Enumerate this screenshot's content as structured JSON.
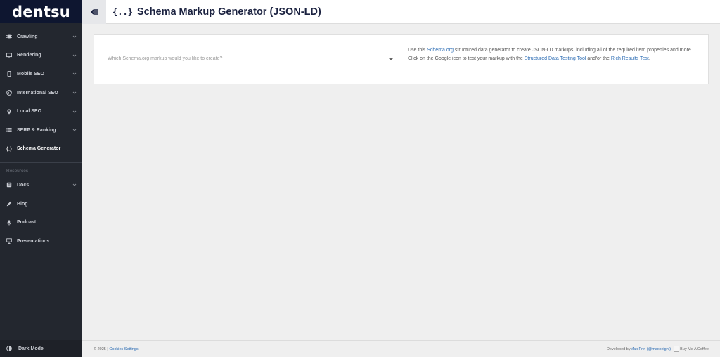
{
  "brand": {
    "logo_text": "dentsu"
  },
  "sidebar": {
    "items": [
      {
        "label": "Crawling",
        "icon": "spider-icon"
      },
      {
        "label": "Rendering",
        "icon": "monitor-icon"
      },
      {
        "label": "Mobile SEO",
        "icon": "mobile-icon"
      },
      {
        "label": "International SEO",
        "icon": "globe-icon"
      },
      {
        "label": "Local SEO",
        "icon": "map-pin-icon"
      },
      {
        "label": "SERP & Ranking",
        "icon": "list-icon"
      },
      {
        "label": "Schema Generator",
        "icon": "braces-icon"
      }
    ],
    "section_label": "Resources",
    "resources": [
      {
        "label": "Docs",
        "icon": "book-icon"
      },
      {
        "label": "Blog",
        "icon": "pencil-icon"
      },
      {
        "label": "Podcast",
        "icon": "microphone-icon"
      },
      {
        "label": "Presentations",
        "icon": "presentation-icon"
      }
    ],
    "dark_mode_label": "Dark Mode"
  },
  "header": {
    "title_icon": "{..}",
    "title": "Schema Markup Generator (JSON-LD)"
  },
  "main": {
    "select_placeholder": "Which Schema.org markup would you like to create?",
    "desc": {
      "t1": "Use this ",
      "link1": "Schema.org",
      "t2": " structured data generator to create JSON-LD markups, including all of the required item properties and more. Click on the Google icon to test your markup with the ",
      "link2": "Structured Data Testing Tool",
      "t3": " and/or the ",
      "link3": "Rich Results Test",
      "t4": "."
    }
  },
  "footer": {
    "copyright": "© 2025 | ",
    "cookies_link": "Cookies Settings",
    "developed_by": "Developed by ",
    "author_link": "Max Prin (@maxxeight)",
    "coffee_alt": "Buy Me A Coffee"
  },
  "colors": {
    "sidebar_bg": "#23272f",
    "logo_bg": "#0e1630",
    "title_color": "#1b2240",
    "link_color": "#2a6bb3"
  }
}
